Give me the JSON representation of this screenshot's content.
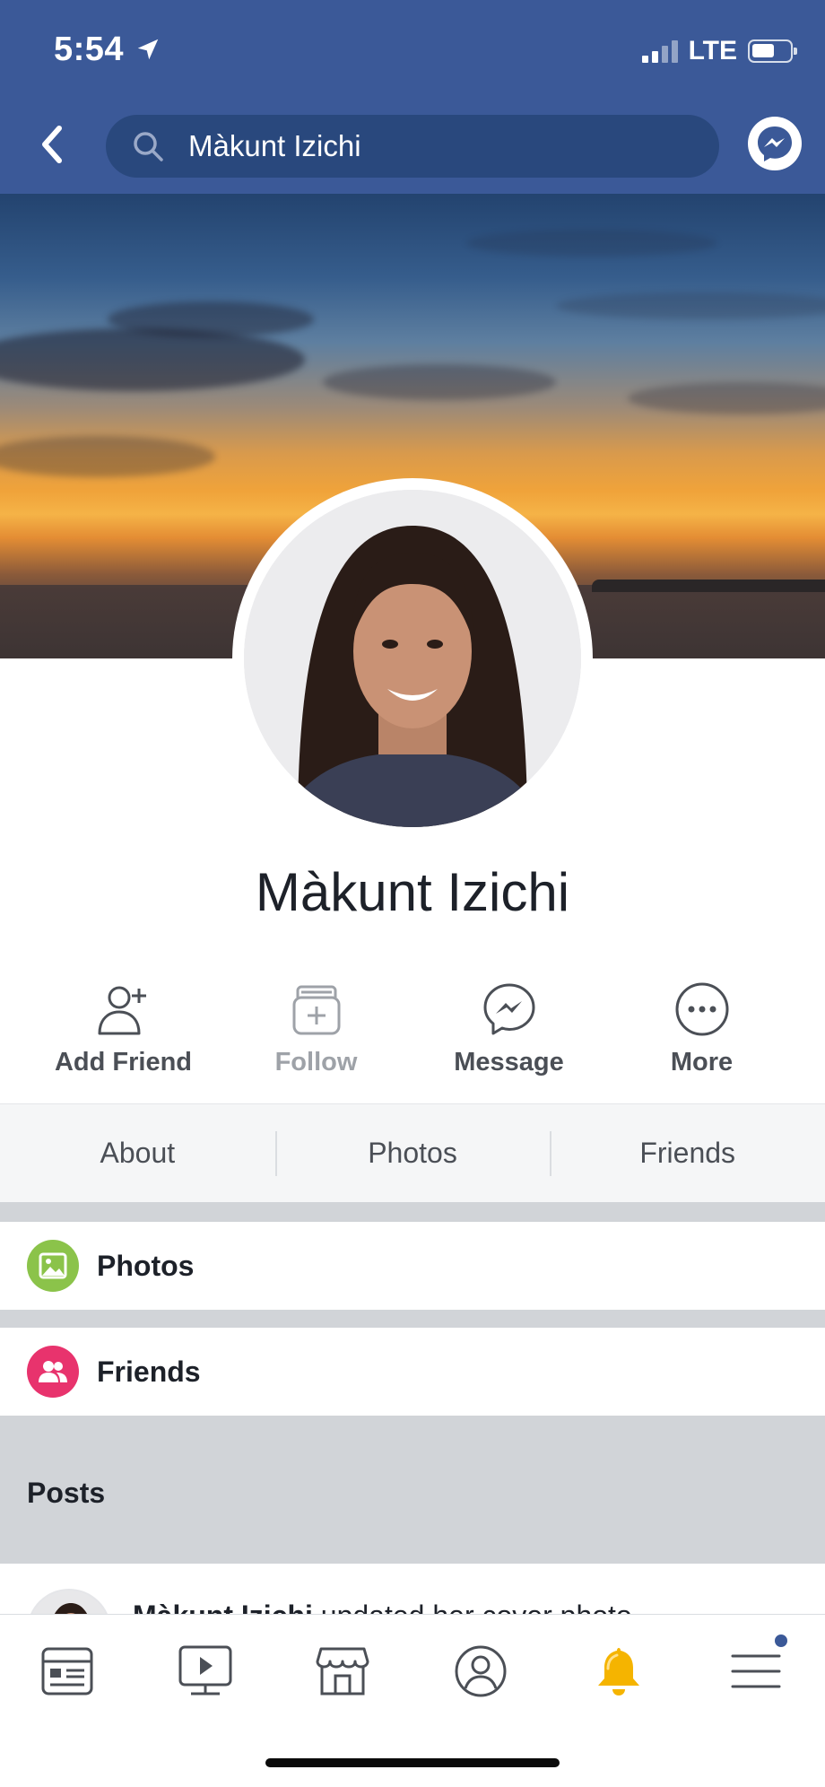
{
  "status_bar": {
    "time": "5:54",
    "network": "LTE"
  },
  "header": {
    "search_value": "Màkunt Izichi"
  },
  "profile": {
    "name": "Màkunt Izichi"
  },
  "actions": {
    "add_friend": "Add Friend",
    "follow": "Follow",
    "message": "Message",
    "more": "More"
  },
  "tabs": {
    "about": "About",
    "photos": "Photos",
    "friends": "Friends"
  },
  "sections": {
    "photos": "Photos",
    "friends": "Friends",
    "posts": "Posts"
  },
  "post": {
    "author": "Màkunt Izichi",
    "action": "updated her cover photo.",
    "menu": "···"
  },
  "colors": {
    "brand": "#3b5998",
    "search_bg": "#29487d",
    "photos_icon": "#8bc34a",
    "friends_icon": "#e8336d",
    "notification_bell": "#f5b400"
  },
  "icons": {
    "back": "chevron-left-icon",
    "search": "search-icon",
    "messenger": "messenger-icon",
    "add_friend": "person-plus-icon",
    "follow": "follow-box-icon",
    "message": "messenger-bubble-icon",
    "more": "more-dots-icon",
    "nav": [
      "news-feed-icon",
      "watch-icon",
      "marketplace-icon",
      "profile-icon",
      "notifications-bell-icon",
      "menu-icon"
    ]
  }
}
